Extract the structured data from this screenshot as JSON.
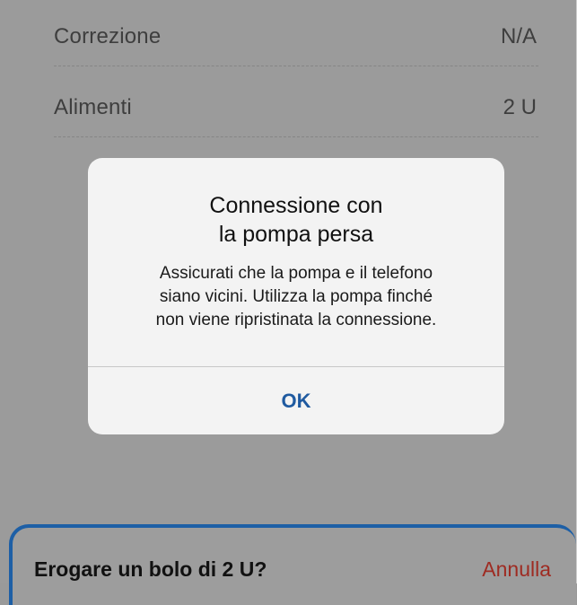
{
  "rows": [
    {
      "label": "Correzione",
      "value": "N/A"
    },
    {
      "label": "Alimenti",
      "value": "2 U"
    }
  ],
  "alert": {
    "title": "Connessione con\nla pompa persa",
    "message": "Assicurati che la pompa e il telefono\nsiano vicini. Utilizza la pompa finché\nnon viene ripristinata la connessione.",
    "ok_label": "OK"
  },
  "sheet": {
    "title": "Erogare un bolo di 2 U?",
    "cancel_label": "Annulla"
  },
  "colors": {
    "accent": "#1f5aa0",
    "destructive": "#9e2b22",
    "overlay": "#9b9b9b"
  }
}
